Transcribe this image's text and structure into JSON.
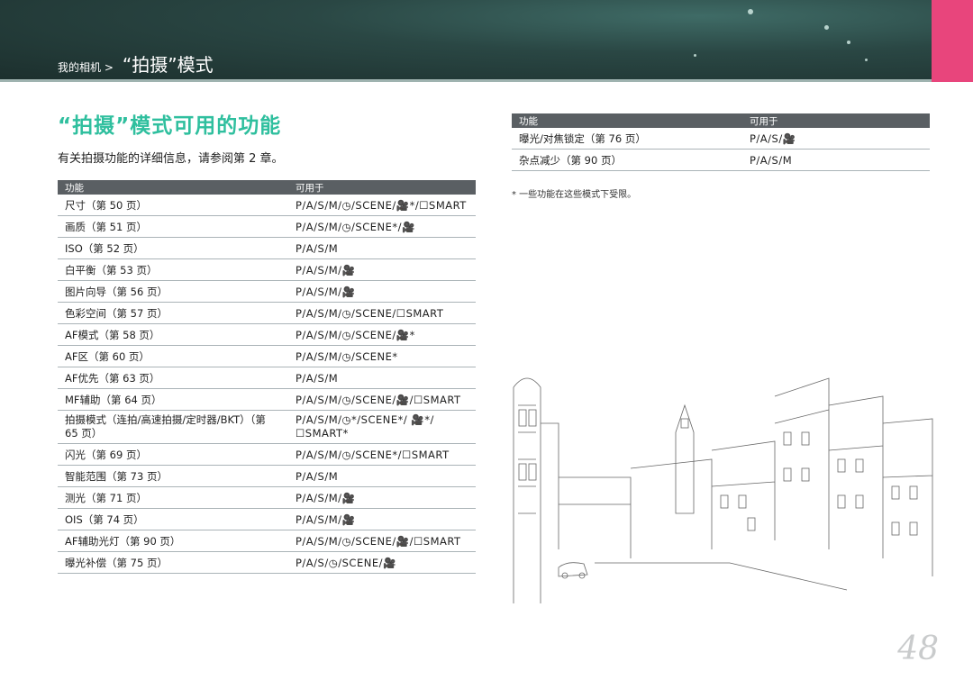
{
  "header": {
    "breadcrumb_small": "我的相机 >",
    "breadcrumb_big": "“拍摄”模式"
  },
  "title": "“拍摄”模式可用的功能",
  "subtitle": "有关拍摄功能的详细信息，请参阅第 2 章。",
  "left_table": {
    "col_function": "功能",
    "col_available": "可用于",
    "rows": [
      {
        "function": "尺寸（第 50 页）",
        "modes": "P/A/S/M/◷/SCENE/🎥*/☐SMART"
      },
      {
        "function": "画质（第 51 页）",
        "modes": "P/A/S/M/◷/SCENE*/🎥"
      },
      {
        "function": "ISO（第 52 页）",
        "modes": "P/A/S/M"
      },
      {
        "function": "白平衡（第 53 页）",
        "modes": "P/A/S/M/🎥"
      },
      {
        "function": "图片向导（第 56 页）",
        "modes": "P/A/S/M/🎥"
      },
      {
        "function": "色彩空间（第 57 页）",
        "modes": "P/A/S/M/◷/SCENE/☐SMART"
      },
      {
        "function": "AF模式（第 58 页）",
        "modes": "P/A/S/M/◷/SCENE/🎥*"
      },
      {
        "function": "AF区（第 60 页）",
        "modes": "P/A/S/M/◷/SCENE*"
      },
      {
        "function": "AF优先（第 63 页）",
        "modes": "P/A/S/M"
      },
      {
        "function": "MF辅助（第 64 页）",
        "modes": "P/A/S/M/◷/SCENE/🎥/☐SMART"
      },
      {
        "function": "拍摄模式（连拍/高速拍摄/定时器/BKT）（第 65 页）",
        "modes": "P/A/S/M/◷*/SCENE*/ 🎥*/☐SMART*"
      },
      {
        "function": "闪光（第 69 页）",
        "modes": "P/A/S/M/◷/SCENE*/☐SMART"
      },
      {
        "function": "智能范围（第 73 页）",
        "modes": "P/A/S/M"
      },
      {
        "function": "测光（第 71 页）",
        "modes": "P/A/S/M/🎥"
      },
      {
        "function": "OIS（第 74 页）",
        "modes": "P/A/S/M/🎥"
      },
      {
        "function": "AF辅助光灯（第 90 页）",
        "modes": "P/A/S/M/◷/SCENE/🎥/☐SMART"
      },
      {
        "function": "曝光补偿（第 75 页）",
        "modes": "P/A/S/◷/SCENE/🎥"
      }
    ]
  },
  "right_table": {
    "col_function": "功能",
    "col_available": "可用于",
    "rows": [
      {
        "function": "曝光/对焦锁定（第 76 页）",
        "modes": "P/A/S/🎥"
      },
      {
        "function": "杂点减少（第 90 页）",
        "modes": "P/A/S/M"
      }
    ]
  },
  "note": "* 一些功能在这些模式下受限。",
  "page_number": "48",
  "colors": {
    "accent": "#2fbf9e",
    "tab": "#e8457c",
    "header_bg": "#2a4744",
    "table_head": "#5a5f63"
  }
}
